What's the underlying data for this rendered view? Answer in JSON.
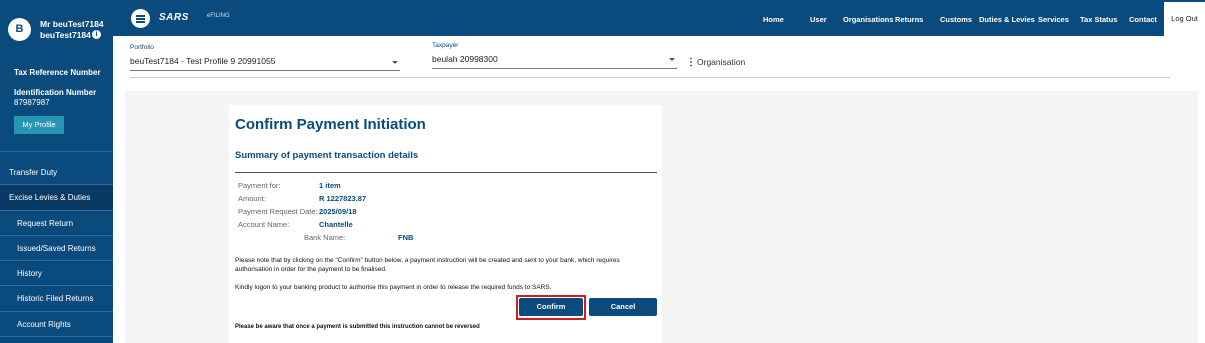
{
  "user": {
    "avatar_letter": "B",
    "name_line1": "Mr beuTest7184",
    "name_line2": "beuTest7184"
  },
  "sidebar": {
    "tax_ref_label": "Tax Reference Number",
    "id_label": "Identification Number",
    "id_value": "87987987",
    "my_profile_label": "My Profile",
    "menu": [
      {
        "label": "Transfer Duty"
      },
      {
        "label": "Excise Levies & Duties"
      },
      {
        "label": "Request Return"
      },
      {
        "label": "Issued/Saved Returns"
      },
      {
        "label": "History"
      },
      {
        "label": "Historic Filed Returns"
      },
      {
        "label": "Account Rights"
      }
    ]
  },
  "topbar": {
    "logo": "SARS",
    "logo_sub": "eFILING",
    "nav": [
      "Home",
      "User",
      "Organisations",
      "Returns",
      "Customs",
      "Duties & Levies",
      "Services",
      "Tax Status",
      "Contact"
    ],
    "logout": "Log Out"
  },
  "selector": {
    "portfolio_label": "Portfolio",
    "portfolio_value": "beuTest7184 - Test Profile 9 20991055",
    "taxpayer_label": "Taxpayer",
    "taxpayer_value": "beulah 20998300",
    "org_label": "Organisation"
  },
  "card": {
    "title": "Confirm Payment Initiation",
    "subtitle": "Summary of payment transaction details",
    "details": [
      {
        "label": "Payment for:",
        "value": "1 item"
      },
      {
        "label": "Amount:",
        "value": "R 1227823.87"
      },
      {
        "label": "Payment Request Date:",
        "value": "2025/09/18"
      },
      {
        "label": "Account Name:",
        "value": "Chantelle"
      }
    ],
    "bank_label": "Bank Name:",
    "bank_value": "FNB",
    "note1": "Please note that by clicking on the \"Confirm\" button below, a payment instruction will be created and sent to your bank, which requires authorisation in order for the payment to be finalised.",
    "note2": "Kindly logon to your banking product to authorise this payment in order to release the required funds to SARS.",
    "confirm_label": "Confirm",
    "cancel_label": "Cancel",
    "warning": "Please be aware that once a payment is submitted this instruction cannot be reversed"
  },
  "colors": {
    "brand": "#0b4a7d",
    "accent": "#2796b3",
    "highlight": "#cc1f1f"
  }
}
